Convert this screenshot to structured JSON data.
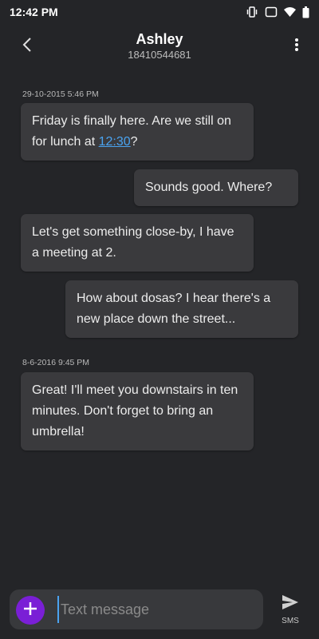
{
  "status_bar": {
    "time": "12:42 PM",
    "icons": [
      "vibrate-icon",
      "cast-icon",
      "wifi-icon",
      "battery-icon"
    ]
  },
  "header": {
    "title": "Ashley",
    "subtitle": "18410544681",
    "icons": [
      "back-arrow-icon",
      "more-vert-icon"
    ]
  },
  "messages": [
    {
      "timestamp": "29-10-2015 5:46 PM",
      "direction": "incoming",
      "text_before": "Friday is finally here. Are we still on for lunch at ",
      "link": "12:30",
      "text_after": "?"
    },
    {
      "direction": "outgoing",
      "text": "Sounds good. Where?"
    },
    {
      "direction": "incoming",
      "text": "Let's get something close-by, I have a meeting at 2."
    },
    {
      "direction": "outgoing",
      "text": "How about dosas? I hear there's a new place down the street..."
    },
    {
      "timestamp": "8-6-2016 9:45 PM",
      "direction": "incoming",
      "text": "Great! I'll meet you downstairs in ten minutes. Don't forget to bring an umbrella!"
    }
  ],
  "compose": {
    "placeholder": "Text message",
    "value": "",
    "send_label": "SMS",
    "icons": [
      "add-icon",
      "send-icon"
    ]
  },
  "colors": {
    "background": "#242528",
    "bubble": "#3a3a3d",
    "accent": "#7a1fd6",
    "link": "#4aa3f0"
  }
}
